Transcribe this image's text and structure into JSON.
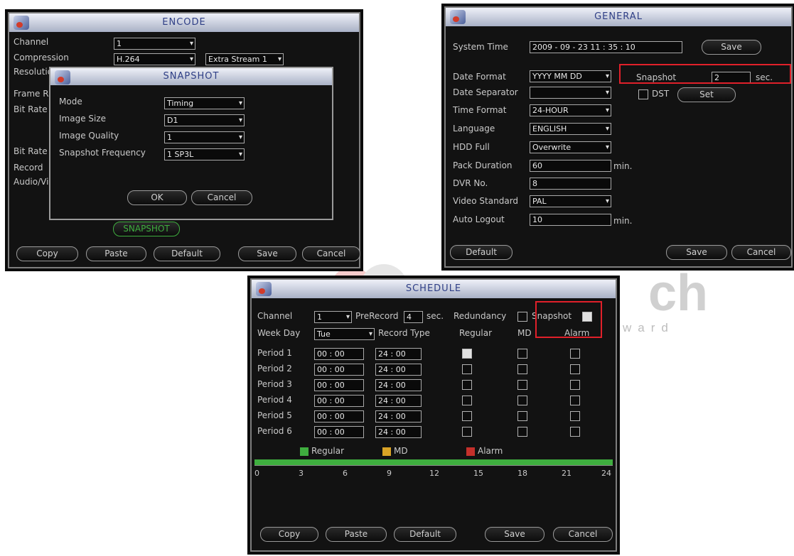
{
  "watermark": {
    "prefix": "A",
    "main": "ch",
    "sub": "ward"
  },
  "encode": {
    "title": "ENCODE",
    "labels": [
      "Channel",
      "Compression",
      "Resolution",
      "Frame Rate",
      "Bit Rate Type",
      "Bit Rate",
      "Record",
      "Audio/Video"
    ],
    "channel_value": "1",
    "compression_value": "H.264",
    "extra_stream_value": "Extra Stream 1",
    "snapshot_button": "SNAPSHOT",
    "buttons": {
      "copy": "Copy",
      "paste": "Paste",
      "default": "Default",
      "save": "Save",
      "cancel": "Cancel"
    },
    "dialog": {
      "title": "SNAPSHOT",
      "mode_label": "Mode",
      "mode_value": "Timing",
      "size_label": "Image Size",
      "size_value": "D1",
      "quality_label": "Image Quality",
      "quality_value": "1",
      "freq_label": "Snapshot Frequency",
      "freq_value": "1 SP3L",
      "ok": "OK",
      "cancel": "Cancel"
    }
  },
  "general": {
    "title": "GENERAL",
    "system_time_label": "System Time",
    "system_time_value": "2009 - 09 - 23  11 : 35 : 10",
    "save_time": "Save",
    "date_format_label": "Date Format",
    "date_format_value": "YYYY MM DD",
    "date_separator_label": "Date Separator",
    "date_separator_value": "",
    "time_format_label": "Time Format",
    "time_format_value": "24-HOUR",
    "language_label": "Language",
    "language_value": "ENGLISH",
    "hdd_full_label": "HDD Full",
    "hdd_full_value": "Overwrite",
    "pack_duration_label": "Pack Duration",
    "pack_duration_value": "60",
    "pack_duration_unit": "min.",
    "dvr_no_label": "DVR No.",
    "dvr_no_value": "8",
    "video_standard_label": "Video Standard",
    "video_standard_value": "PAL",
    "auto_logout_label": "Auto Logout",
    "auto_logout_value": "10",
    "auto_logout_unit": "min.",
    "snapshot_label": "Snapshot",
    "snapshot_value": "2",
    "snapshot_unit": "sec.",
    "dst_label": "DST",
    "dst_set": "Set",
    "buttons": {
      "default": "Default",
      "save": "Save",
      "cancel": "Cancel"
    }
  },
  "schedule": {
    "title": "SCHEDULE",
    "channel_label": "Channel",
    "channel_value": "1",
    "prerecord_label": "PreRecord",
    "prerecord_value": "4",
    "prerecord_unit": "sec.",
    "redundancy_label": "Redundancy",
    "snapshot_label": "Snapshot",
    "weekday_label": "Week Day",
    "weekday_value": "Tue",
    "record_type_label": "Record Type",
    "col_regular": "Regular",
    "col_md": "MD",
    "col_alarm": "Alarm",
    "periods": [
      {
        "label": "Period 1",
        "start": "00 : 00",
        "end": "24 : 00",
        "regular": true
      },
      {
        "label": "Period 2",
        "start": "00 : 00",
        "end": "24 : 00",
        "regular": false
      },
      {
        "label": "Period 3",
        "start": "00 : 00",
        "end": "24 : 00",
        "regular": false
      },
      {
        "label": "Period 4",
        "start": "00 : 00",
        "end": "24 : 00",
        "regular": false
      },
      {
        "label": "Period 5",
        "start": "00 : 00",
        "end": "24 : 00",
        "regular": false
      },
      {
        "label": "Period 6",
        "start": "00 : 00",
        "end": "24 : 00",
        "regular": false
      }
    ],
    "legend": {
      "regular": "Regular",
      "md": "MD",
      "alarm": "Alarm"
    },
    "timeline_hours": [
      "0",
      "3",
      "6",
      "9",
      "12",
      "15",
      "18",
      "21",
      "24"
    ],
    "buttons": {
      "copy": "Copy",
      "paste": "Paste",
      "default": "Default",
      "save": "Save",
      "cancel": "Cancel"
    }
  },
  "colors": {
    "regular": "#3fae3f",
    "md": "#d9a326",
    "alarm": "#c4302b",
    "highlight": "#e0202a",
    "title_text": "#2f3f86"
  }
}
